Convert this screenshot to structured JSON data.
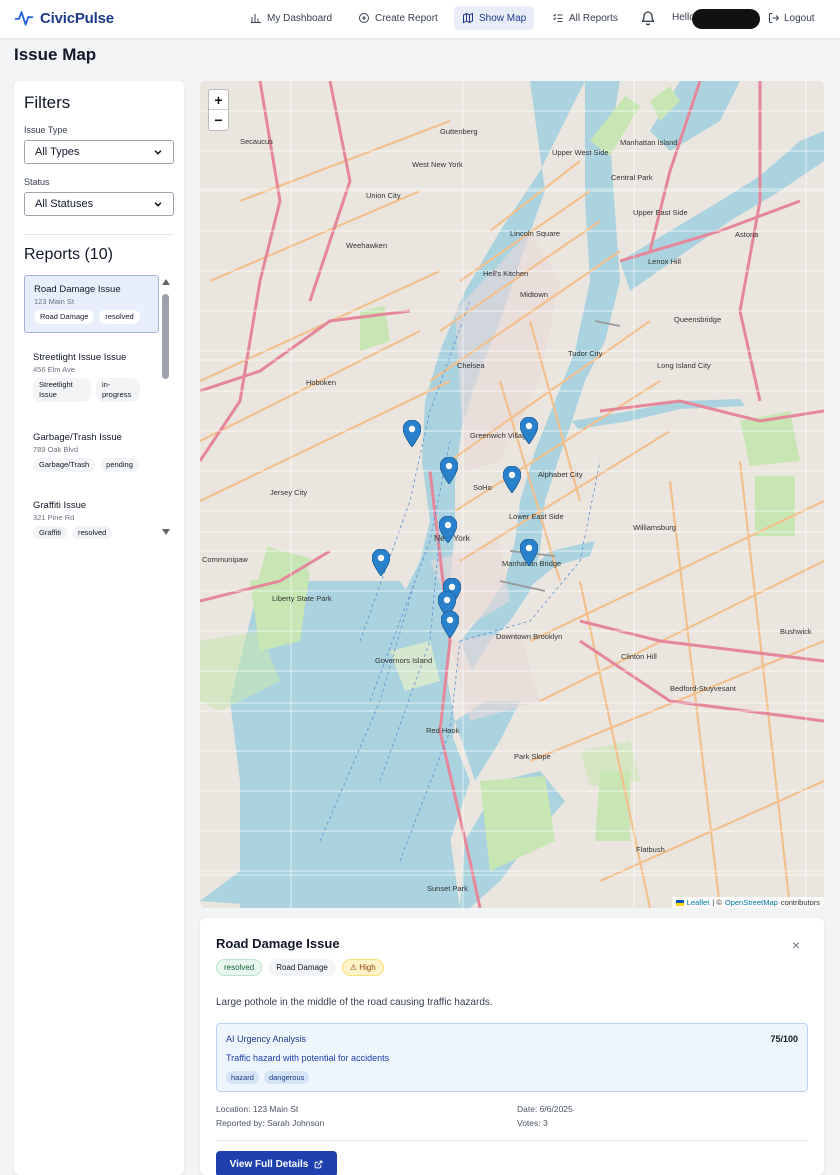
{
  "brand": {
    "name": "CivicPulse"
  },
  "nav": {
    "dashboard": "My Dashboard",
    "create": "Create Report",
    "map": "Show Map",
    "reports": "All Reports",
    "hello": "Hello",
    "logout": "Logout"
  },
  "page": {
    "title": "Issue Map"
  },
  "filters": {
    "title": "Filters",
    "issue_type_label": "Issue Type",
    "issue_type_value": "All Types",
    "status_label": "Status",
    "status_value": "All Statuses"
  },
  "reports": {
    "title": "Reports (10)",
    "items": [
      {
        "title": "Road Damage Issue",
        "address": "123 Main St",
        "category": "Road Damage",
        "status": "resolved"
      },
      {
        "title": "Streetlight Issue Issue",
        "address": "456 Elm Ave",
        "category": "Streetlight Issue",
        "status": "in-progress"
      },
      {
        "title": "Garbage/Trash Issue",
        "address": "789 Oak Blvd",
        "category": "Garbage/Trash",
        "status": "pending"
      },
      {
        "title": "Graffiti Issue",
        "address": "321 Pine Rd",
        "category": "Graffiti",
        "status": "resolved"
      }
    ]
  },
  "map": {
    "zoom_in": "+",
    "zoom_out": "−",
    "attribution_leaflet": "Leaflet",
    "attribution_sep": "| ©",
    "attribution_osm": "OpenStreetMap",
    "attribution_tail": "contributors",
    "labels": {
      "manhattan": "Manhattan Island",
      "new_york": "New York",
      "jersey_city": "Jersey City",
      "hoboken": "Hoboken",
      "brooklyn": "Downtown Brooklyn",
      "williamsburg": "Williamsburg",
      "astoria": "Astoria",
      "queensbridge": "Queensbridge",
      "midtown": "Midtown",
      "chelsea": "Chelsea",
      "soho": "SoHo",
      "greenwich": "Greenwich Village",
      "harlem": "Upper West Side",
      "upper_east": "Upper East Side",
      "lenox": "Lenox Hill",
      "bed_stuy": "Bedford-Stuyvesant",
      "bushwick": "Bushwick",
      "flatbush": "Flatbush",
      "park_slope": "Park Slope",
      "red_hook": "Red Hook",
      "sunset": "Sunset Park",
      "clinton": "Clinton Hill",
      "weehawken": "Weehawken",
      "union_city": "Union City",
      "west_ny": "West New York",
      "guttenberg": "Guttenberg",
      "secaucus": "Secaucus",
      "governors": "Governors Island",
      "lic": "Long Island City",
      "hells": "Hell's Kitchen",
      "lincoln": "Lincoln Square",
      "alphabet": "Alphabet City",
      "les": "Lower East Side",
      "manh_bridge": "Manhattan Bridge",
      "tudor": "Tudor City",
      "central_park": "Central Park",
      "communipaw": "Communipaw",
      "liberty": "Liberty State Park"
    }
  },
  "detail": {
    "title": "Road Damage Issue",
    "close": "×",
    "status": "resolved",
    "category": "Road Damage",
    "priority": "⚠ High",
    "description": "Large pothole in the middle of the road causing traffic hazards.",
    "ai": {
      "title": "AI Urgency Analysis",
      "score": "75/100",
      "text": "Traffic hazard with potential for accidents",
      "tags": [
        "hazard",
        "dangerous"
      ]
    },
    "location": "Location: 123 Main St",
    "reporter": "Reported by: Sarah Johnson",
    "date": "Date: 6/6/2025",
    "votes": "Votes: 3",
    "button": "View Full Details"
  },
  "colors": {
    "brand": "#1e3a8a",
    "accent": "#1e40af",
    "water": "#aad3df",
    "park": "#c8e6b4",
    "marker": "#2a81cb"
  }
}
